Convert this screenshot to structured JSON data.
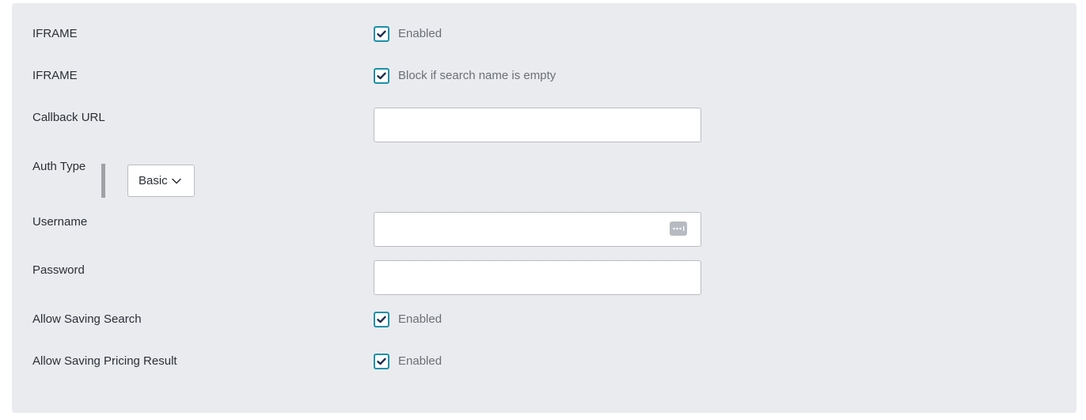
{
  "form": {
    "rows": {
      "iframe_enabled": {
        "label": "IFRAME",
        "checkbox_label": "Enabled",
        "checked": true
      },
      "iframe_block": {
        "label": "IFRAME",
        "checkbox_label": "Block if search name is empty",
        "checked": true
      },
      "callback_url": {
        "label": "Callback URL",
        "value": "",
        "placeholder": ""
      },
      "auth_type": {
        "label": "Auth Type",
        "selected": "Basic"
      },
      "username": {
        "label": "Username",
        "value": "",
        "placeholder": ""
      },
      "password": {
        "label": "Password",
        "value": "",
        "placeholder": ""
      },
      "allow_saving_search": {
        "label": "Allow Saving Search",
        "checkbox_label": "Enabled",
        "checked": true
      },
      "allow_saving_pricing": {
        "label": "Allow Saving Pricing Result",
        "checkbox_label": "Enabled",
        "checked": true
      }
    }
  },
  "icons": {
    "checkmark": "check-icon",
    "dropdown": "chevron-down-icon",
    "password_manager": "password-manager-icon"
  },
  "colors": {
    "panel_bg": "#eaebee",
    "checkbox_border": "#1b8fa8",
    "checkmark": "#1f2d4d",
    "label_text": "#2b2f36",
    "muted_text": "#6b6f76",
    "input_border": "#b9bcc2"
  }
}
